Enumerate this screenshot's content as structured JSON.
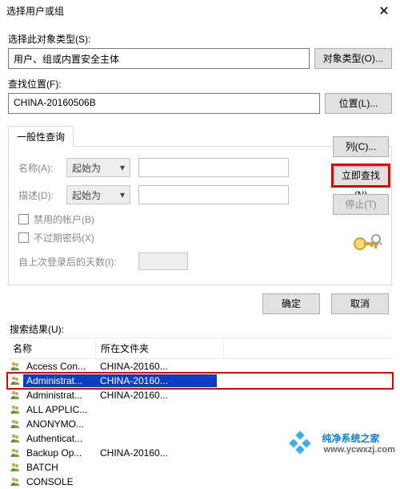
{
  "window": {
    "title": "选择用户或组",
    "close_glyph": "✕"
  },
  "objtype": {
    "label": "选择此对象类型(S):",
    "value": "用户、组或内置安全主体",
    "button": "对象类型(O)..."
  },
  "location": {
    "label": "查找位置(F):",
    "value": "CHINA-20160506B",
    "button": "位置(L)..."
  },
  "tab": {
    "label": "一般性查询"
  },
  "criteria": {
    "name_label": "名称(A):",
    "desc_label": "描述(D):",
    "select_text": "起始为",
    "chevron": "▾",
    "chk_disabled": "禁用的帐户(B)",
    "chk_noexpire": "不过期密码(X)",
    "days_label": "自上次登录后的天数(I):"
  },
  "rightbuttons": {
    "columns": "列(C)...",
    "findnow": "立即查找(N)",
    "stop": "停止(T)"
  },
  "dlg": {
    "ok": "确定",
    "cancel": "取消"
  },
  "results": {
    "label": "搜索结果(U):",
    "col_name": "名称",
    "col_folder": "所在文件夹",
    "rows": [
      {
        "name": "Access Con...",
        "folder": "CHINA-20160...",
        "selected": false
      },
      {
        "name": "Administrat...",
        "folder": "CHINA-20160...",
        "selected": true
      },
      {
        "name": "Administrat...",
        "folder": "CHINA-20160...",
        "selected": false
      },
      {
        "name": "ALL APPLIC...",
        "folder": "",
        "selected": false
      },
      {
        "name": "ANONYMO...",
        "folder": "",
        "selected": false
      },
      {
        "name": "Authenticat...",
        "folder": "",
        "selected": false
      },
      {
        "name": "Backup Op...",
        "folder": "CHINA-20160...",
        "selected": false
      },
      {
        "name": "BATCH",
        "folder": "",
        "selected": false
      },
      {
        "name": "CONSOLE",
        "folder": "",
        "selected": false
      }
    ]
  },
  "watermark": {
    "brand": "纯净系统之家",
    "url": "www.ycwxzj.com"
  }
}
